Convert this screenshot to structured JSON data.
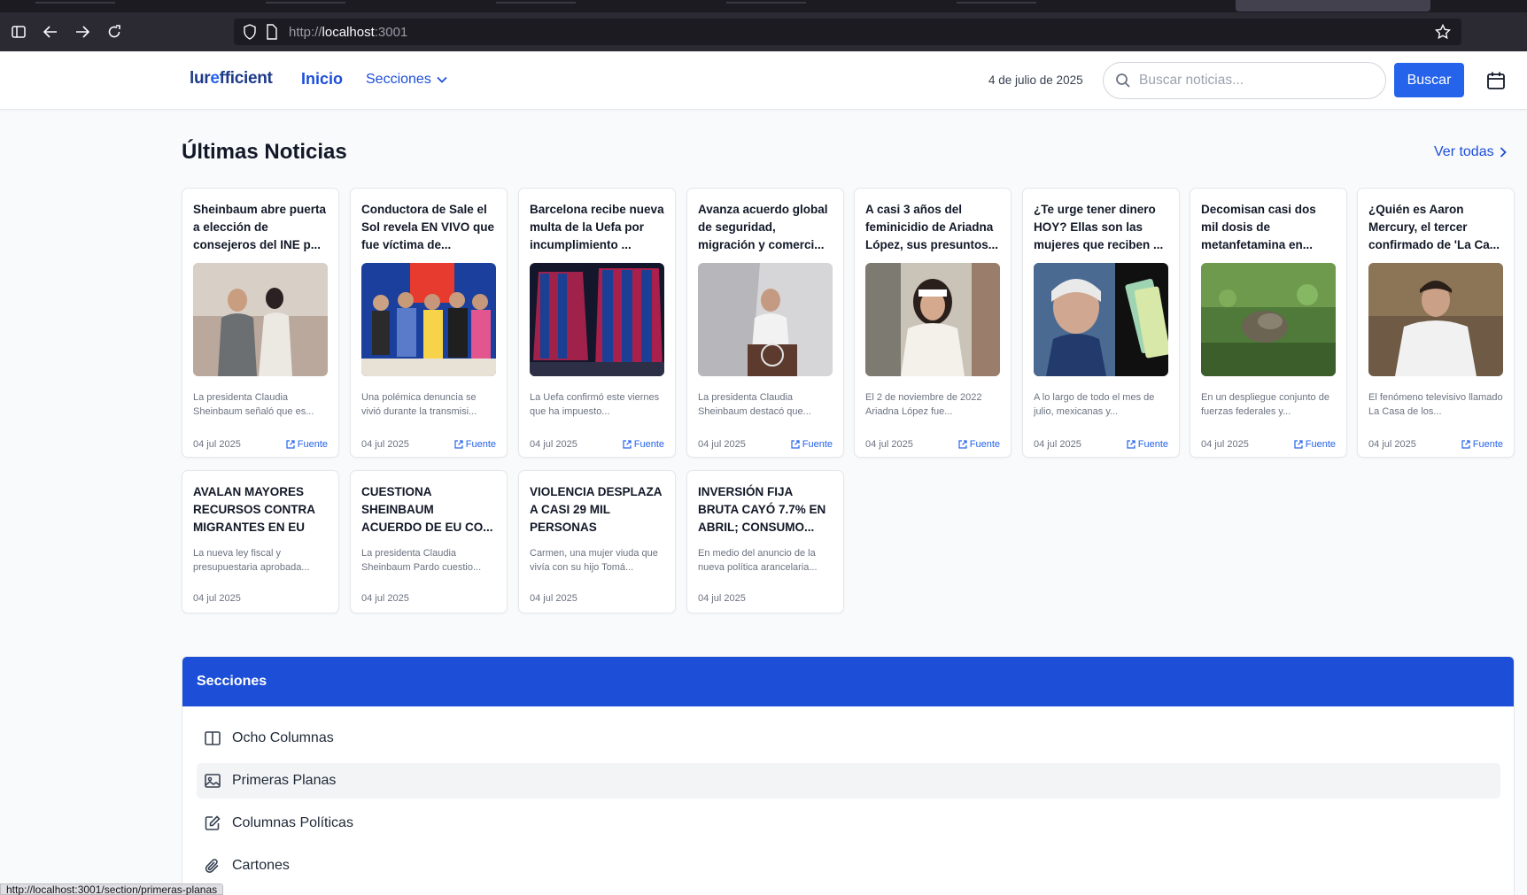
{
  "browser": {
    "url_scheme": "http://",
    "url_host": "localhost",
    "url_port": ":3001",
    "status_url": "http://localhost:3001/section/primeras-planas"
  },
  "header": {
    "logo_pre": "lur",
    "logo_accent": "e",
    "logo_post": "fficient",
    "nav_inicio": "Inicio",
    "nav_secciones": "Secciones",
    "date": "4 de julio de 2025",
    "search_placeholder": "Buscar noticias...",
    "search_button": "Buscar"
  },
  "latest": {
    "title": "Últimas Noticias",
    "see_all": "Ver todas",
    "source_label": "Fuente",
    "cards": [
      {
        "headline": "Sheinbaum abre puerta a elección de consejeros del INE p...",
        "summary": "La presidenta Claudia Sheinbaum señaló que es...",
        "date": "04 jul 2025"
      },
      {
        "headline": "Conductora de Sale el Sol revela EN VIVO que fue víctima de...",
        "summary": "Una polémica denuncia se vivió durante la transmisi...",
        "date": "04 jul 2025"
      },
      {
        "headline": "Barcelona recibe nueva multa de la Uefa por incumplimiento ...",
        "summary": "La Uefa confirmó este viernes que ha impuesto...",
        "date": "04 jul 2025"
      },
      {
        "headline": "Avanza acuerdo global de seguridad, migración y comerci...",
        "summary": "La presidenta Claudia Sheinbaum destacó que...",
        "date": "04 jul 2025"
      },
      {
        "headline": "A casi 3 años del feminicidio de Ariadna López, sus presuntos...",
        "summary": "El 2 de noviembre de 2022 Ariadna López fue...",
        "date": "04 jul 2025"
      },
      {
        "headline": "¿Te urge tener dinero HOY? Ellas son las mujeres que reciben ...",
        "summary": "A lo largo de todo el mes de julio, mexicanas y...",
        "date": "04 jul 2025"
      },
      {
        "headline": "Decomisan casi dos mil dosis de metanfetamina en...",
        "summary": "En un despliegue conjunto de fuerzas federales y...",
        "date": "04 jul 2025"
      },
      {
        "headline": "¿Quién es Aaron Mercury, el tercer confirmado de 'La Ca...",
        "summary": "El fenómeno televisivo llamado La Casa de los...",
        "date": "04 jul 2025"
      }
    ],
    "cards_text": [
      {
        "headline": "AVALAN MAYORES RECURSOS CONTRA MIGRANTES EN EU",
        "summary": "La nueva ley fiscal y presupuestaria aprobada...",
        "date": "04 jul 2025"
      },
      {
        "headline": "CUESTIONA SHEINBAUM ACUERDO DE EU CO...",
        "summary": "La presidenta Claudia Sheinbaum Pardo cuestio...",
        "date": "04 jul 2025"
      },
      {
        "headline": "VIOLENCIA DESPLAZA A CASI 29 MIL PERSONAS",
        "summary": "Carmen, una mujer viuda que vivía con su hijo Tomá...",
        "date": "04 jul 2025"
      },
      {
        "headline": "INVERSIÓN FIJA BRUTA CAYÓ 7.7% EN ABRIL; CONSUMO...",
        "summary": "En medio del anuncio de la nueva política arancelaria...",
        "date": "04 jul 2025"
      }
    ]
  },
  "sections": {
    "title": "Secciones",
    "items": [
      {
        "label": "Ocho Columnas",
        "icon": "columns-icon"
      },
      {
        "label": "Primeras Planas",
        "icon": "image-icon"
      },
      {
        "label": "Columnas Políticas",
        "icon": "edit-icon"
      },
      {
        "label": "Cartones",
        "icon": "paperclip-icon"
      }
    ]
  },
  "colors": {
    "primary": "#2563eb",
    "section_header": "#1d4ed8",
    "logo_dark": "#1e3a8a"
  }
}
